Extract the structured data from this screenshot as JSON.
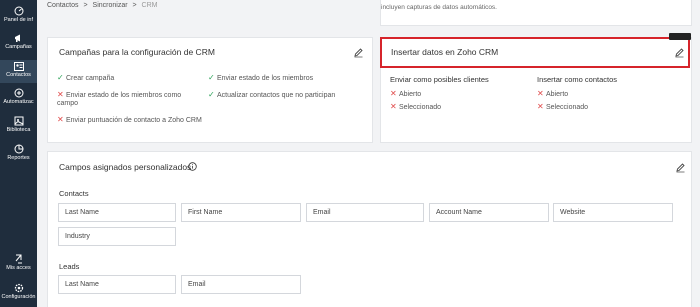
{
  "sidebar": {
    "items": [
      {
        "label": "Panel de inf",
        "icon": "dashboard-icon"
      },
      {
        "label": "Campañas",
        "icon": "megaphone-icon"
      },
      {
        "label": "Contactos",
        "icon": "contacts-icon"
      },
      {
        "label": "Automatizac",
        "icon": "automation-icon"
      },
      {
        "label": "Biblioteca",
        "icon": "library-icon"
      },
      {
        "label": "Reportes",
        "icon": "reports-icon"
      },
      {
        "label": "Mis acces",
        "icon": "shortcuts-icon"
      },
      {
        "label": "Configuración",
        "icon": "gear-icon"
      }
    ],
    "active": "Contactos"
  },
  "breadcrumb": {
    "items": [
      "Contactos",
      ">",
      "Sincronizar",
      ">",
      "CRM"
    ]
  },
  "top_note": "incluyen capturas de datos automáticos.",
  "crm_campaigns": {
    "title": "Campañas para la configuración de CRM",
    "left_items": [
      {
        "text": "Crear campaña",
        "status": "check"
      },
      {
        "text": "Enviar estado de los miembros como",
        "status": "cross"
      },
      {
        "text": "campo",
        "status": "none"
      },
      {
        "text": "Enviar puntuación de contacto a Zoho CRM",
        "status": "cross"
      }
    ],
    "right_items": [
      {
        "text": "Enviar estado de los miembros",
        "status": "check"
      },
      {
        "text": "Actualizar contactos que no participan",
        "status": "check"
      }
    ]
  },
  "zoho_insert": {
    "title": "Insertar datos en Zoho CRM",
    "columns": [
      {
        "heading": "Enviar como posibles clientes",
        "items": [
          "Abierto",
          "Seleccionado"
        ]
      },
      {
        "heading": "Insertar como contactos",
        "items": [
          "Abierto",
          "Seleccionado"
        ]
      }
    ]
  },
  "custom_fields": {
    "title": "Campos asignados personalizados",
    "groups": [
      {
        "label": "Contacts",
        "fields": [
          "Last Name",
          "First Name",
          "Email",
          "Account Name",
          "Website",
          "Industry"
        ]
      },
      {
        "label": "Leads",
        "fields": [
          "Last Name",
          "Email"
        ]
      }
    ]
  },
  "colors": {
    "sidebar_bg": "#1f2d3d",
    "highlight": "#d6242b",
    "check": "#2fa35a",
    "cross": "#e04a4a"
  }
}
